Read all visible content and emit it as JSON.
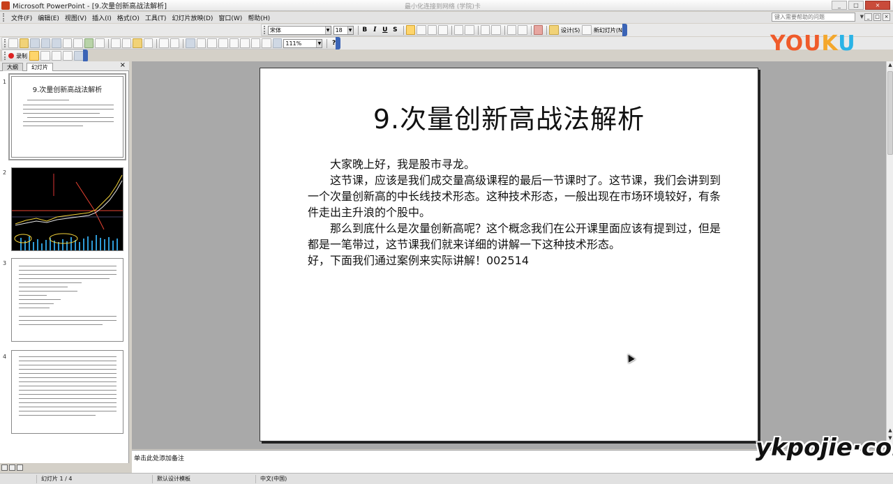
{
  "window": {
    "title": "Microsoft PowerPoint - [9.次量创新高战法解析]",
    "faint_title": "最小化连接到网络 (学院)卡",
    "controls": [
      "_",
      "□",
      "×"
    ]
  },
  "menu": {
    "items": [
      "文件(F)",
      "编辑(E)",
      "视图(V)",
      "插入(I)",
      "格式(O)",
      "工具(T)",
      "幻灯片放映(D)",
      "窗口(W)",
      "帮助(H)"
    ],
    "help_placeholder": "键入需要帮助的问题"
  },
  "formatting": {
    "font": "宋体",
    "size": "18",
    "bold": "B",
    "italic": "I",
    "underline": "U",
    "shadow": "S",
    "design_label": "设计(S)",
    "new_slide_label": "新幻灯片(N)"
  },
  "standard": {
    "zoom": "111%",
    "help": "?"
  },
  "record": {
    "label": "录制"
  },
  "left_pane": {
    "tabs": [
      "大纲",
      "幻灯片"
    ],
    "close": "×",
    "slides": [
      {
        "number": "1",
        "title": "9.次量创新高战法解析"
      },
      {
        "number": "2"
      },
      {
        "number": "3"
      },
      {
        "number": "4"
      }
    ]
  },
  "slide": {
    "title": "9.次量创新高战法解析",
    "paragraphs": [
      "大家晚上好，我是股市寻龙。",
      "这节课，应该是我们成交量高级课程的最后一节课时了。这节课，我们会讲到到一个次量创新高的中长线技术形态。这种技术形态，一般出现在市场环境较好，有条件走出主升浪的个股中。",
      "那么到底什么是次量创新高呢？这个概念我们在公开课里面应该有提到过，但是都是一笔带过，这节课我们就来详细的讲解一下这种技术形态。",
      "好，下面我们通过案例来实际讲解！002514"
    ]
  },
  "notes": {
    "placeholder": "单击此处添加备注"
  },
  "status": {
    "slide_counter": "幻灯片 1 / 4",
    "template": "默认设计模板",
    "language": "中文(中国)"
  },
  "watermarks": {
    "youku_parts": [
      "YOU",
      "K",
      "U"
    ],
    "ykpojie": "ykpojie·com"
  }
}
